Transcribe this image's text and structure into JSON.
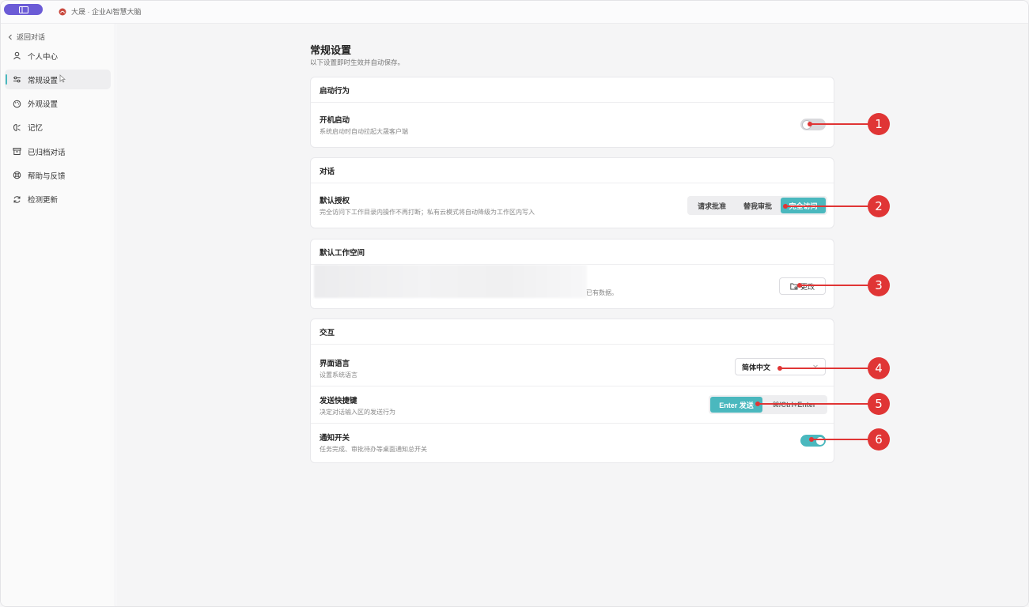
{
  "titlebar": {
    "app_title": "大晟 · 企业AI智慧大脑"
  },
  "sidebar": {
    "back_label": "返回对话",
    "items": [
      {
        "label": "个人中心",
        "icon": "user-icon"
      },
      {
        "label": "常规设置",
        "icon": "sliders-icon",
        "active": true
      },
      {
        "label": "外观设置",
        "icon": "palette-icon"
      },
      {
        "label": "记忆",
        "icon": "brain-icon"
      },
      {
        "label": "已归档对话",
        "icon": "archive-icon"
      },
      {
        "label": "帮助与反馈",
        "icon": "help-icon"
      },
      {
        "label": "检测更新",
        "icon": "refresh-icon"
      }
    ]
  },
  "page": {
    "title": "常规设置",
    "subtitle": "以下设置即时生效并自动保存。"
  },
  "startup": {
    "header": "启动行为",
    "autostart_title": "开机启动",
    "autostart_desc": "系统启动时自动拉起大晟客户端",
    "autostart_on": false
  },
  "dialog": {
    "header": "对话",
    "auth_title": "默认授权",
    "auth_desc": "完全访问下工作目录内操作不再打断；私有云模式将自动降级为工作区内写入",
    "options": [
      "请求批准",
      "替我审批",
      "完全访问"
    ],
    "selected": "完全访问"
  },
  "workspace": {
    "header": "默认工作空间",
    "desc_tail": "已有数据。",
    "change_label": "更改"
  },
  "interaction": {
    "header": "交互",
    "lang_title": "界面语言",
    "lang_desc": "设置系统语言",
    "lang_value": "简体中文",
    "send_title": "发送快捷键",
    "send_desc": "决定对话输入区的发送行为",
    "send_options": [
      "Enter 发送",
      "⌘/Ctrl+Enter"
    ],
    "send_selected": "Enter 发送",
    "notify_title": "通知开关",
    "notify_desc": "任务完成、审批待办等桌面通知总开关",
    "notify_on": true
  },
  "callouts": [
    "1",
    "2",
    "3",
    "4",
    "5",
    "6"
  ],
  "colors": {
    "accent": "#4ab8be",
    "callout": "#e03535",
    "brand": "#6b5bd6"
  }
}
